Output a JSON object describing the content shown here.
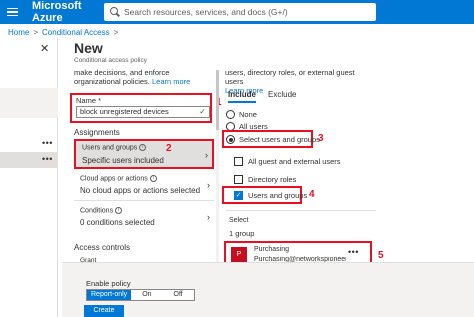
{
  "topbar": {
    "brand": "Microsoft Azure",
    "search_placeholder": "Search resources, services, and docs (G+/)"
  },
  "breadcrumb": [
    "Home",
    "Conditional Access"
  ],
  "leftpane": {
    "dots": "•••"
  },
  "blade": {
    "title": "New",
    "subtitle": "Conditional access policy",
    "intro_text": "make decisions, and enforce organizational policies.",
    "intro_link": "Learn more"
  },
  "name_field": {
    "label": "Name *",
    "value": "block unregistered devices"
  },
  "assignments": {
    "heading": "Assignments",
    "users": {
      "title": "Users and groups",
      "value": "Specific users included"
    },
    "cloud": {
      "title": "Cloud apps or actions",
      "value": "No cloud apps or actions selected"
    },
    "conditions": {
      "title": "Conditions",
      "value": "0 conditions selected"
    }
  },
  "access_controls": {
    "heading": "Access controls",
    "grant": "Grant"
  },
  "right": {
    "desc": "users, directory roles, or external guest users",
    "desc_link": "Learn more",
    "tabs": [
      "Include",
      "Exclude"
    ],
    "radios": [
      "None",
      "All users",
      "Select users and groups"
    ],
    "checkboxes": [
      "All guest and external users",
      "Directory roles",
      "Users and groups"
    ],
    "select_label": "Select",
    "group_count": "1 group",
    "group": {
      "avatar": "P",
      "name": "Purchasing",
      "email": "Purchasing@networkspioneer...",
      "dots": "•••"
    }
  },
  "callouts": [
    "1",
    "2",
    "3",
    "4",
    "5"
  ],
  "footer": {
    "enable_label": "Enable policy",
    "options": [
      "Report-only",
      "On",
      "Off"
    ],
    "create": "Create"
  },
  "colors": {
    "accent": "#0078d4",
    "callout": "#e81123"
  }
}
